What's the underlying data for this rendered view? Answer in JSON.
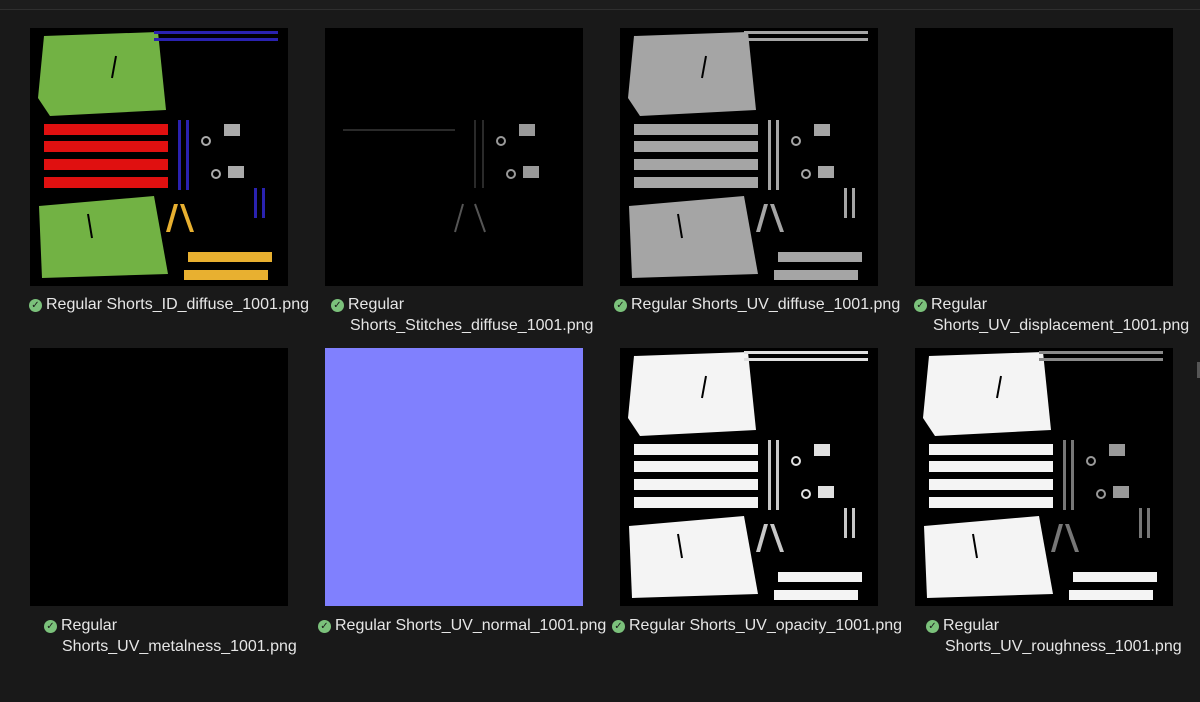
{
  "files": [
    {
      "line1": "Regular Shorts_ID_diffuse_1001.png",
      "line2": "",
      "status": "synced",
      "map": "id"
    },
    {
      "line1": "Regular",
      "line2": "Shorts_Stitches_diffuse_1001.png",
      "status": "synced",
      "map": "stitches"
    },
    {
      "line1": "Regular Shorts_UV_diffuse_1001.png",
      "line2": "",
      "status": "synced",
      "map": "grey"
    },
    {
      "line1": "Regular",
      "line2": "Shorts_UV_displacement_1001.png",
      "status": "synced",
      "map": "black"
    },
    {
      "line1": "Regular",
      "line2": "Shorts_UV_metalness_1001.png",
      "status": "synced",
      "map": "black"
    },
    {
      "line1": "Regular Shorts_UV_normal_1001.png",
      "line2": "",
      "status": "synced",
      "map": "normal"
    },
    {
      "line1": "Regular Shorts_UV_opacity_1001.png",
      "line2": "",
      "status": "synced",
      "map": "white"
    },
    {
      "line1": "Regular",
      "line2": "Shorts_UV_roughness_1001.png",
      "status": "synced",
      "map": "white"
    }
  ],
  "colors": {
    "background": "#191919",
    "status_icon": "#7bc17b",
    "id_panel": "#72b244",
    "id_band": "#e01010",
    "id_strap": "#2a22b0",
    "id_tape": "#e8b030",
    "uv_grey": "#a5a5a5",
    "uv_white": "#f4f4f4",
    "normal_blue": "#8080fe"
  },
  "icons": {
    "status": "check-circle-icon"
  }
}
